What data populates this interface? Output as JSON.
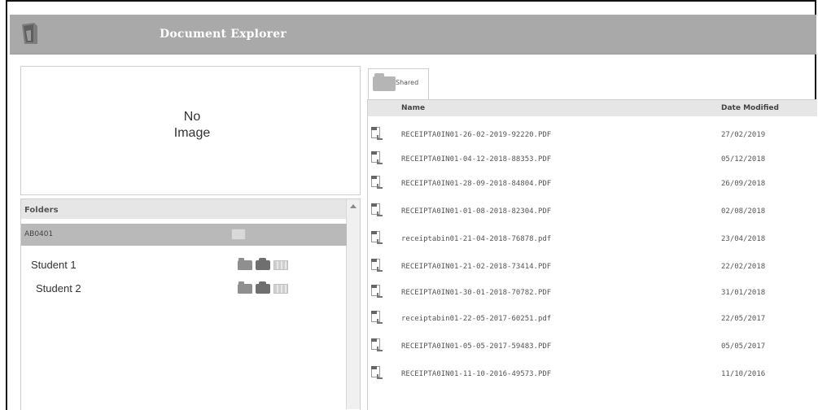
{
  "header": {
    "title": "Document Explorer",
    "app_icon": "document-explorer-logo-icon"
  },
  "preview": {
    "text": "No\nImage"
  },
  "folders": {
    "title": "Folders",
    "selected_row": "AB0401",
    "students": [
      {
        "label": "Student 1"
      },
      {
        "label": "Student 2"
      }
    ]
  },
  "tabs": [
    {
      "label": "Shared",
      "icon": "folder-icon"
    }
  ],
  "filelist": {
    "columns": {
      "name": "Name",
      "date": "Date Modified"
    },
    "files": [
      {
        "name": "RECEIPTA0IN01-26-02-2019-92220.PDF",
        "date": "27/02/2019"
      },
      {
        "name": "RECEIPTA0IN01-04-12-2018-88353.PDF",
        "date": "05/12/2018"
      },
      {
        "name": "RECEIPTA0IN01-28-09-2018-84804.PDF",
        "date": "26/09/2018"
      },
      {
        "name": "RECEIPTA0IN01-01-08-2018-82304.PDF",
        "date": "02/08/2018"
      },
      {
        "name": "receiptabin01-21-04-2018-76878.pdf",
        "date": "23/04/2018"
      },
      {
        "name": "RECEIPTA0IN01-21-02-2018-73414.PDF",
        "date": "22/02/2018"
      },
      {
        "name": "RECEIPTA0IN01-30-01-2018-70782.PDF",
        "date": "31/01/2018"
      },
      {
        "name": "receiptabin01-22-05-2017-60251.pdf",
        "date": "22/05/2017"
      },
      {
        "name": "RECEIPTA0IN01-05-05-2017-59483.PDF",
        "date": "05/05/2017"
      },
      {
        "name": "RECEIPTA0IN01-11-10-2016-49573.PDF",
        "date": "11/10/2016"
      }
    ]
  }
}
